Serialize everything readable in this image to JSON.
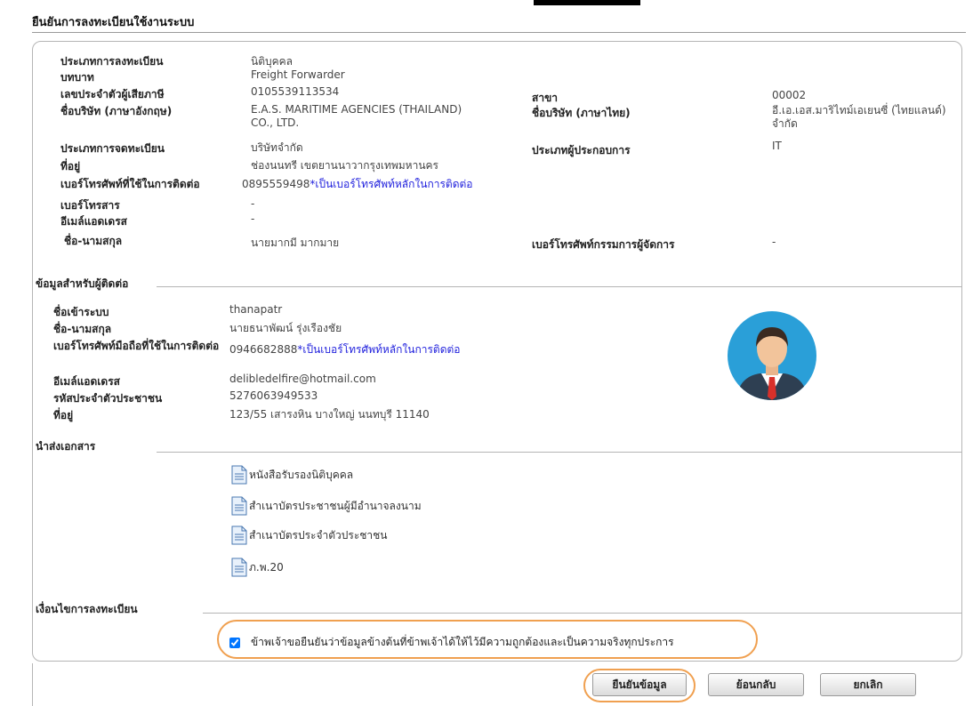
{
  "page": {
    "title": "ยืนยันการลงทะเบียนใช้งานระบบ"
  },
  "registrant": {
    "reg_type_label": "ประเภทการลงทะเบียน",
    "reg_type_value": "นิติบุคคล",
    "role_label": "บทบาท",
    "role_value": "Freight Forwarder",
    "tax_id_label": "เลขประจำตัวผู้เสียภาษี",
    "tax_id_value": "0105539113534",
    "branch_label": "สาขา",
    "branch_value": "00002",
    "company_en_label": "ชื่อบริษัท (ภาษาอังกฤษ)",
    "company_en_value": "E.A.S. MARITIME AGENCIES (THAILAND) CO., LTD.",
    "company_th_label": "ชื่อบริษัท (ภาษาไทย)",
    "company_th_value": "อี.เอ.เอส.มาริไทม์เอเยนซี่ (ไทยแลนด์) จำกัด",
    "registration_type_label": "ประเภทการจดทะเบียน",
    "registration_type_value": "บริษัทจำกัด",
    "operator_type_label": "ประเภทผู้ประกอบการ",
    "operator_type_value": "IT",
    "address_label": "ที่อยู่",
    "address_value": "ช่องนนทรี เขตยานนาวากรุงเทพมหานคร",
    "contact_phone_label": "เบอร์โทรศัพท์ที่ใช้ในการติดต่อ",
    "contact_phone_value": "0895559498",
    "contact_phone_note": "*เป็นเบอร์โทรศัพท์หลักในการติดต่อ",
    "fax_label": "เบอร์โทรสาร",
    "fax_value": "-",
    "email_label": "อีเมล์แอดเดรส",
    "email_value": "-",
    "name_label": "ชื่อ-นามสกุล",
    "name_value": "นายมากมี มากมาย",
    "director_phone_label": "เบอร์โทรศัพท์กรรมการผู้จัดการ",
    "director_phone_value": "-"
  },
  "contact": {
    "section_label": "ข้อมูลสำหรับผู้ติดต่อ",
    "username_label": "ชื่อเข้าระบบ",
    "username_value": "thanapatr",
    "name_label": "ชื่อ-นามสกุล",
    "name_value": "นายธนาพัฒน์ รุ่งเรืองชัย",
    "mobile_label": "เบอร์โทรศัพท์มือถือที่ใช้ในการติดต่อ",
    "mobile_value": "0946682888",
    "mobile_note": "*เป็นเบอร์โทรศัพท์หลักในการติดต่อ",
    "email_label": "อีเมล์แอดเดรส",
    "email_value": "delibledelfire@hotmail.com",
    "citizen_id_label": "รหัสประจำตัวประชาชน",
    "citizen_id_value": "5276063949533",
    "address_label": "ที่อยู่",
    "address_value": "123/55 เสารงหิน บางใหญ่ นนทบุรี 11140",
    "avatar_icon": "user-avatar-icon"
  },
  "documents": {
    "section_label": "นำส่งเอกสาร",
    "items": [
      {
        "label": "หนังสือรับรองนิติบุคคล"
      },
      {
        "label": "สำเนาบัตรประชาชนผู้มีอำนาจลงนาม"
      },
      {
        "label": "สำเนาบัตรประจำตัวประชาชน"
      },
      {
        "label": "ภ.พ.20"
      }
    ]
  },
  "terms": {
    "section_label": "เงื่อนไขการลงทะเบียน",
    "agree_text": "ข้าพเจ้าขอยืนยันว่าข้อมูลข้างต้นที่ข้าพเจ้าได้ให้ไว้มีความถูกต้องและเป็นความจริงทุกประการ",
    "agree_checked": true
  },
  "buttons": {
    "confirm": "ยืนยันข้อมูล",
    "back": "ย้อนกลับ",
    "cancel": "ยกเลิก"
  },
  "colors": {
    "highlight": "#f0a050",
    "link": "#2222dd"
  }
}
